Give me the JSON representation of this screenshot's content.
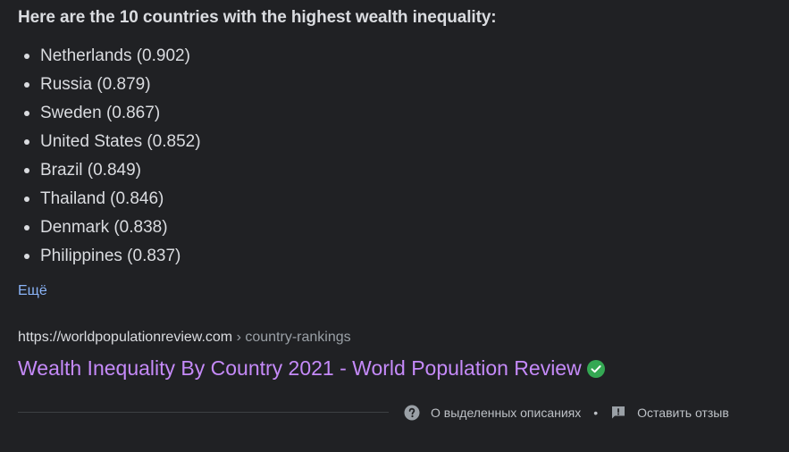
{
  "snippet": {
    "heading": "Here are the 10 countries with the highest wealth inequality:",
    "items": [
      "Netherlands (0.902)",
      "Russia (0.879)",
      "Sweden (0.867)",
      "United States (0.852)",
      "Brazil (0.849)",
      "Thailand (0.846)",
      "Denmark (0.838)",
      "Philippines (0.837)"
    ],
    "more_label": "Ещё"
  },
  "result": {
    "url_domain": "https://worldpopulationreview.com",
    "url_path": " › country-rankings",
    "title": "Wealth Inequality By Country 2021 - World Population Review",
    "verified_icon": "check-circle-icon"
  },
  "footer": {
    "about_label": "О выделенных описаниях",
    "separator": "•",
    "feedback_label": "Оставить отзыв",
    "about_icon": "help-circle-icon",
    "feedback_icon": "feedback-icon"
  },
  "colors": {
    "background": "#202124",
    "text": "#dadce0",
    "link": "#8ab4f8",
    "visited_title": "#c58af9",
    "verified": "#34a853"
  }
}
